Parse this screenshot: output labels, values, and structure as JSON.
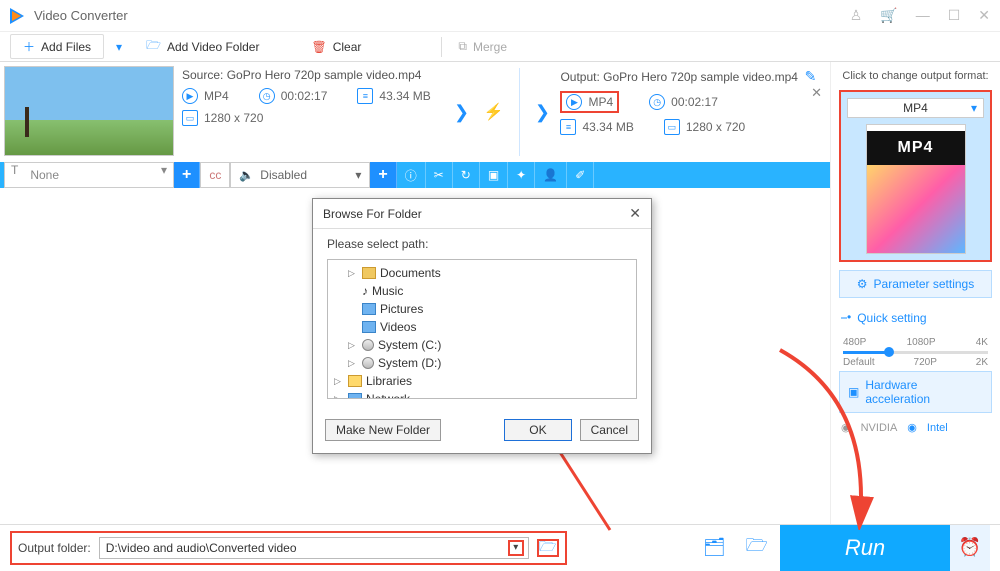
{
  "title": "Video Converter",
  "toolbar": {
    "add_files": "Add Files",
    "add_folder": "Add Video Folder",
    "clear": "Clear",
    "merge": "Merge"
  },
  "file": {
    "source_label": "Source:",
    "source_name": "GoPro Hero 720p sample video.mp4",
    "output_label": "Output:",
    "output_name": "GoPro Hero 720p sample video.mp4",
    "format": "MP4",
    "duration": "00:02:17",
    "size": "43.34 MB",
    "resolution": "1280 x 720"
  },
  "subtitle": {
    "value": "None",
    "audio": "Disabled"
  },
  "right": {
    "hd": "Click to change output format:",
    "format": "MP4",
    "param": "Parameter settings",
    "quick": "Quick setting",
    "ticks_top": [
      "480P",
      "1080P",
      "4K"
    ],
    "ticks_bot": [
      "Default",
      "720P",
      "2K"
    ],
    "hw": "Hardware acceleration",
    "nvidia": "NVIDIA",
    "intel": "Intel"
  },
  "dialog": {
    "title": "Browse For Folder",
    "prompt": "Please select path:",
    "items": [
      "Documents",
      "Music",
      "Pictures",
      "Videos",
      "System (C:)",
      "System (D:)",
      "Libraries",
      "Network"
    ],
    "make": "Make New Folder",
    "ok": "OK",
    "cancel": "Cancel"
  },
  "bottom": {
    "label": "Output folder:",
    "path": "D:\\video and audio\\Converted video",
    "run": "Run"
  }
}
